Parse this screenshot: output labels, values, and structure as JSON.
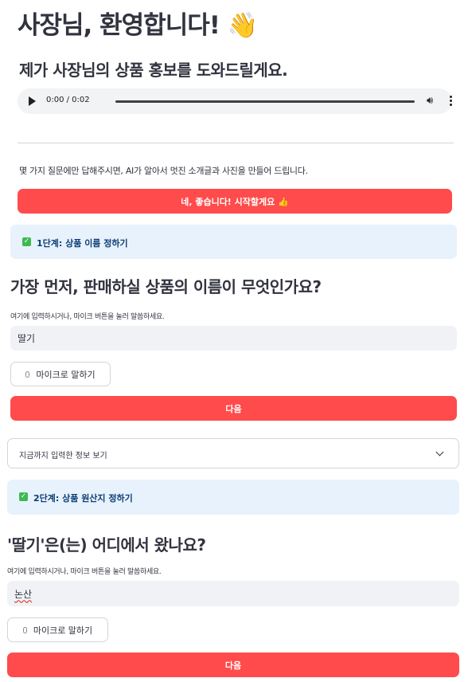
{
  "header": {
    "title": "사장님, 환영합니다! 👋",
    "subtitle": "제가 사장님의 상품 홍보를 도와드릴게요."
  },
  "audio": {
    "time": "0:00 / 0:02",
    "progress": 0.0
  },
  "intro": {
    "description": "몇 가지 질문에만 답해주시면, AI가 알아서 멋진 소개글과 사진을 만들어 드립니다.",
    "start_button": "네, 좋습니다! 시작할게요 👍"
  },
  "step1": {
    "banner": "1단계: 상품 이름 정하기",
    "question": "가장 먼저, 판매하실 상품의 이름이 무엇인가요?",
    "hint": "여기에 입력하시거나, 마이크 버튼을 눌러 말씀하세요.",
    "input_value": "딸기",
    "mic_button": "마이크로 말하기",
    "next_button": "다음"
  },
  "expander": {
    "label": "지금까지 입력한 정보 보기"
  },
  "step2": {
    "banner": "2단계: 상품 원산지 정하기",
    "question": "'딸기'은(는) 어디에서 왔나요?",
    "hint": "여기에 입력하시거나, 마이크 버튼을 눌러 말씀하세요.",
    "input_value": "논산",
    "mic_button": "마이크로 말하기",
    "next_button": "다음"
  },
  "colors": {
    "primary": "#ff4b4b",
    "info_bg": "#e8f2fc",
    "info_text": "#0b3d73",
    "success": "#3fb950"
  }
}
